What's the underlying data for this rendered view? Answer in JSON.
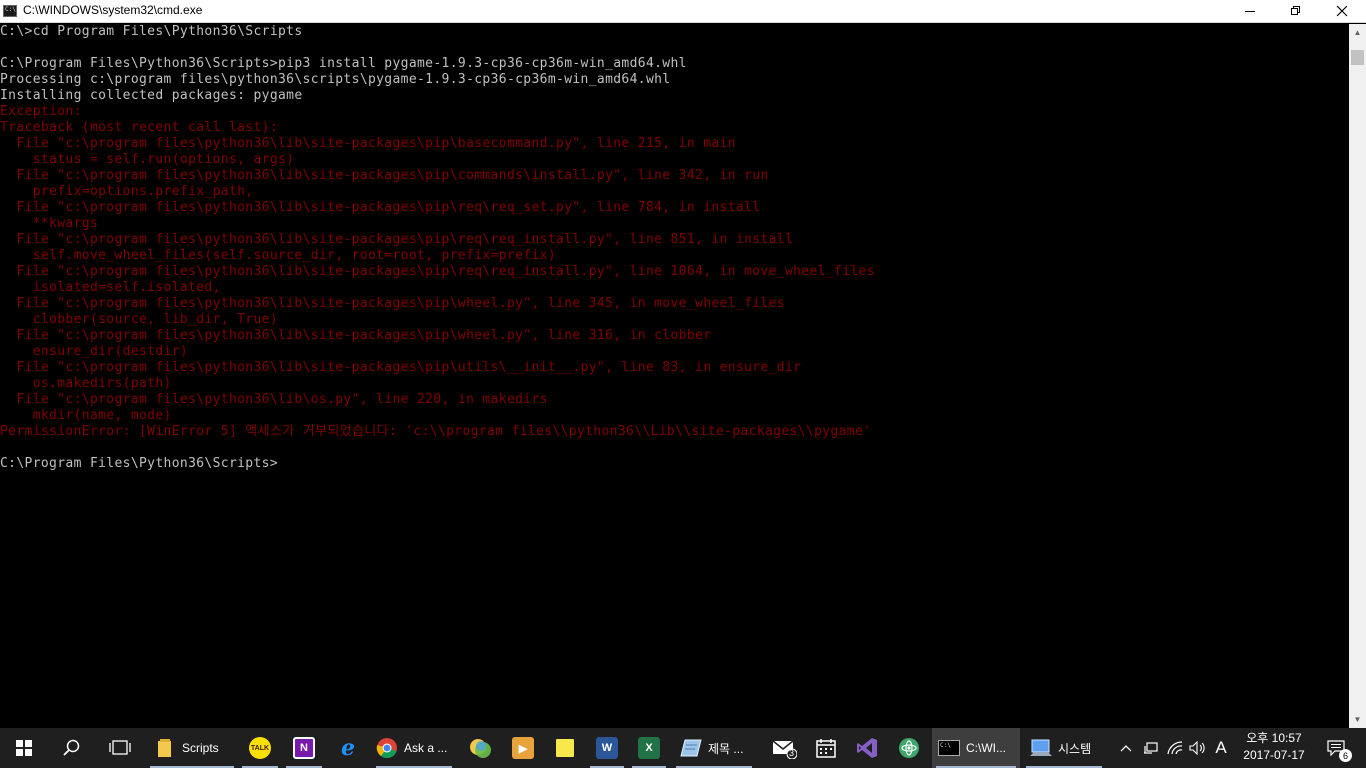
{
  "window": {
    "title": "C:\\WINDOWS\\system32\\cmd.exe",
    "minimize_icon": "minimize-icon",
    "maximize_icon": "restore-icon",
    "close_icon": "close-icon"
  },
  "console": {
    "lines": [
      {
        "text": "C:\\>cd Program Files\\Python36\\Scripts",
        "style": "normal"
      },
      {
        "text": "",
        "style": "normal"
      },
      {
        "text": "C:\\Program Files\\Python36\\Scripts>pip3 install pygame-1.9.3-cp36-cp36m-win_amd64.whl",
        "style": "normal"
      },
      {
        "text": "Processing c:\\program files\\python36\\scripts\\pygame-1.9.3-cp36-cp36m-win_amd64.whl",
        "style": "normal"
      },
      {
        "text": "Installing collected packages: pygame",
        "style": "normal"
      },
      {
        "text": "Exception:",
        "style": "error"
      },
      {
        "text": "Traceback (most recent call last):",
        "style": "error"
      },
      {
        "text": "  File \"c:\\program files\\python36\\lib\\site-packages\\pip\\basecommand.py\", line 215, in main",
        "style": "error"
      },
      {
        "text": "    status = self.run(options, args)",
        "style": "error"
      },
      {
        "text": "  File \"c:\\program files\\python36\\lib\\site-packages\\pip\\commands\\install.py\", line 342, in run",
        "style": "error"
      },
      {
        "text": "    prefix=options.prefix_path,",
        "style": "error"
      },
      {
        "text": "  File \"c:\\program files\\python36\\lib\\site-packages\\pip\\req\\req_set.py\", line 784, in install",
        "style": "error"
      },
      {
        "text": "    **kwargs",
        "style": "error"
      },
      {
        "text": "  File \"c:\\program files\\python36\\lib\\site-packages\\pip\\req\\req_install.py\", line 851, in install",
        "style": "error"
      },
      {
        "text": "    self.move_wheel_files(self.source_dir, root=root, prefix=prefix)",
        "style": "error"
      },
      {
        "text": "  File \"c:\\program files\\python36\\lib\\site-packages\\pip\\req\\req_install.py\", line 1064, in move_wheel_files",
        "style": "error"
      },
      {
        "text": "    isolated=self.isolated,",
        "style": "error"
      },
      {
        "text": "  File \"c:\\program files\\python36\\lib\\site-packages\\pip\\wheel.py\", line 345, in move_wheel_files",
        "style": "error"
      },
      {
        "text": "    clobber(source, lib_dir, True)",
        "style": "error"
      },
      {
        "text": "  File \"c:\\program files\\python36\\lib\\site-packages\\pip\\wheel.py\", line 316, in clobber",
        "style": "error"
      },
      {
        "text": "    ensure_dir(destdir)",
        "style": "error"
      },
      {
        "text": "  File \"c:\\program files\\python36\\lib\\site-packages\\pip\\utils\\__init__.py\", line 83, in ensure_dir",
        "style": "error"
      },
      {
        "text": "    os.makedirs(path)",
        "style": "error"
      },
      {
        "text": "  File \"c:\\program files\\python36\\lib\\os.py\", line 220, in makedirs",
        "style": "error"
      },
      {
        "text": "    mkdir(name, mode)",
        "style": "error"
      },
      {
        "text": "PermissionError: [WinError 5] 액세스가 거부되었습니다: 'c:\\\\program files\\\\python36\\\\Lib\\\\site-packages\\\\pygame'",
        "style": "error"
      },
      {
        "text": "",
        "style": "normal"
      },
      {
        "text": "C:\\Program Files\\Python36\\Scripts>",
        "style": "normal"
      }
    ]
  },
  "scrollbar": {
    "up_icon": "scroll-up-arrow-icon",
    "down_icon": "scroll-down-arrow-icon"
  },
  "taskbar": {
    "start_icon": "windows-start-icon",
    "search_icon": "search-icon",
    "task_view_icon": "task-view-icon",
    "apps": [
      {
        "name": "file-explorer",
        "label": "Scripts",
        "icon": "folder-icon",
        "color": "#f2c94c"
      },
      {
        "name": "kakaotalk",
        "label": "",
        "icon": "kakaotalk-icon",
        "badge_text": "TALK",
        "color": "#f9e000"
      },
      {
        "name": "onenote",
        "label": "",
        "icon": "onenote-icon",
        "badge_text": "N",
        "color": "#7719aa"
      },
      {
        "name": "internet-explorer",
        "label": "",
        "icon": "internet-explorer-icon",
        "badge_text": "e",
        "color": "#1e90ff"
      },
      {
        "name": "chrome",
        "label": "Ask a ...",
        "icon": "chrome-icon",
        "color": "#db4437"
      },
      {
        "name": "app-bubbles",
        "label": "",
        "icon": "bubbles-icon",
        "color": "#6abf4b"
      },
      {
        "name": "media-player",
        "label": "",
        "icon": "media-player-icon",
        "color": "#e8a33d"
      },
      {
        "name": "sticky-notes",
        "label": "",
        "icon": "sticky-notes-icon",
        "color": "#f7e84b"
      },
      {
        "name": "word",
        "label": "",
        "icon": "word-icon",
        "badge_text": "W",
        "color": "#2b579a"
      },
      {
        "name": "excel",
        "label": "",
        "icon": "excel-icon",
        "badge_text": "X",
        "color": "#217346"
      },
      {
        "name": "untitled-app",
        "label": "제목 ...",
        "icon": "notepad-icon",
        "color": "#9fc5e8"
      },
      {
        "name": "mail",
        "label": "",
        "icon": "mail-icon",
        "badge_text": "3",
        "color": "#ffffff"
      },
      {
        "name": "calendar",
        "label": "",
        "icon": "calendar-icon",
        "color": "#ffffff"
      },
      {
        "name": "visual-studio",
        "label": "",
        "icon": "visual-studio-icon",
        "color": "#865fc5"
      },
      {
        "name": "app-atom",
        "label": "",
        "icon": "atom-icon",
        "color": "#3ea66b"
      },
      {
        "name": "cmd",
        "label": "C:\\WI...",
        "icon": "cmd-icon",
        "color": "#000000"
      },
      {
        "name": "system",
        "label": "시스템",
        "icon": "system-icon",
        "color": "#5ea0ef"
      }
    ],
    "tray": {
      "chevron_icon": "chevron-up-icon",
      "network_icon": "network-icon",
      "wifi_icon": "wifi-icon",
      "volume_icon": "volume-icon",
      "ime_label": "A",
      "time": "오후 10:57",
      "date": "2017-07-17",
      "notification_icon": "notification-icon",
      "notification_count": "6"
    }
  }
}
